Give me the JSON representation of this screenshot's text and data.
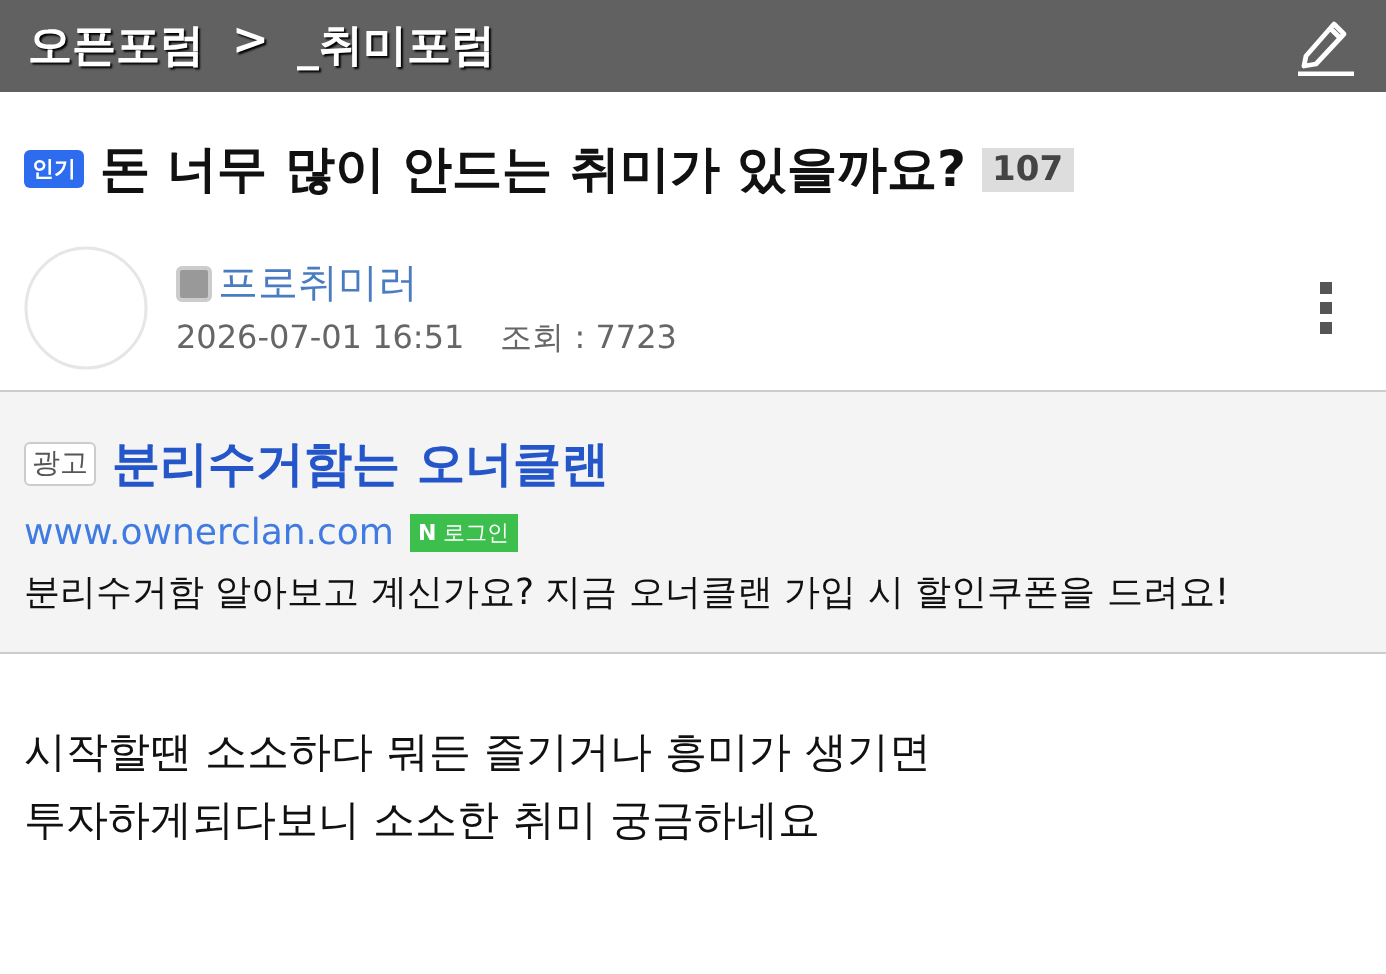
{
  "header": {
    "breadcrumb": [
      "오픈포럼",
      ">",
      "_취미포럼"
    ]
  },
  "post": {
    "badge": "인기",
    "title": "돈 너무 많이 안드는 취미가 있을까요?",
    "comment_count": "107",
    "author": "프로취미러",
    "date": "2026-07-01 16:51",
    "views": "조회 : 7723"
  },
  "ad": {
    "tag": "광고",
    "title": "분리수거함는 오너클랜",
    "url": "www.ownerclan.com",
    "login_badge": {
      "letter": "N",
      "label": "로그인"
    },
    "text": "분리수거함 알아보고 계신가요? 지금 오너클랜 가입 시 할인쿠폰을 드려요!"
  },
  "body": {
    "lines": [
      "시작할땐 소소하다 뭐든 즐기거나 흥미가 생기면",
      "투자하게되다보니 소소한 취미 궁금하네요"
    ]
  }
}
